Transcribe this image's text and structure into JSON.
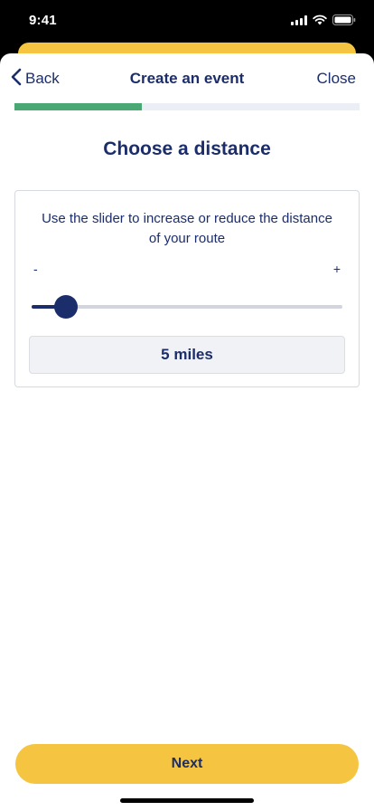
{
  "status_bar": {
    "time": "9:41",
    "icons": [
      "signal-icon",
      "wifi-icon",
      "battery-icon"
    ]
  },
  "nav": {
    "back_label": "Back",
    "back_icon": "chevron-left-icon",
    "title": "Create an event",
    "close_label": "Close"
  },
  "progress": {
    "fraction": 0.37,
    "fill_color": "#4aa874",
    "track_color": "#eceef5"
  },
  "main": {
    "title": "Choose a distance",
    "description": "Use the slider to increase or reduce the distance of your route",
    "slider": {
      "minus_label": "-",
      "plus_label": "+",
      "fraction": 0.11
    },
    "value_display": "5 miles"
  },
  "footer": {
    "next_label": "Next"
  },
  "colors": {
    "primary": "#1b2d6b",
    "accent": "#f5c542",
    "progress": "#4aa874"
  }
}
